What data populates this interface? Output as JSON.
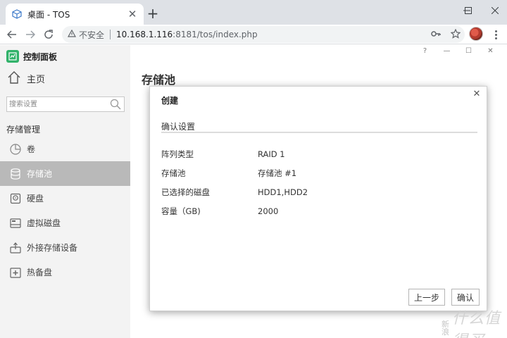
{
  "browser": {
    "tab_title": "桌面 - TOS",
    "tab_close": "✕",
    "new_tab": "+",
    "minimize": "—",
    "maximize": "☐",
    "close": "✕",
    "insecure_label": "不安全",
    "url_host": "10.168.1.116",
    "url_rest": ":8181/tos/index.php"
  },
  "sidebar": {
    "app_title": "控制面板",
    "home_label": "主页",
    "search_placeholder": "搜索设置",
    "section_title": "存储管理",
    "items": [
      {
        "label": "卷",
        "icon": "pie-chart-icon",
        "active": false
      },
      {
        "label": "存储池",
        "icon": "database-icon",
        "active": true
      },
      {
        "label": "硬盘",
        "icon": "hard-disk-icon",
        "active": false
      },
      {
        "label": "虚拟磁盘",
        "icon": "virtual-disk-icon",
        "active": false
      },
      {
        "label": "外接存储设备",
        "icon": "usb-drive-icon",
        "active": false
      },
      {
        "label": "热备盘",
        "icon": "hot-spare-icon",
        "active": false
      }
    ]
  },
  "main": {
    "help": "?",
    "minimize": "—",
    "maximize": "☐",
    "close": "✕",
    "page_title": "存储池"
  },
  "modal": {
    "title": "创建",
    "close": "✕",
    "section_title": "确认设置",
    "rows": [
      {
        "label": "阵列类型",
        "value": "RAID 1"
      },
      {
        "label": "存储池",
        "value": "存储池 #1"
      },
      {
        "label": "已选择的磁盘",
        "value": "HDD1,HDD2"
      },
      {
        "label": "容量（GB)",
        "value": "2000"
      }
    ],
    "prev_button": "上一步",
    "confirm_button": "确认"
  },
  "watermark": {
    "vertical_text": "新浪",
    "text": "什么值得买"
  },
  "colors": {
    "sidebar_bg": "#f3f3f3",
    "active_item_bg": "#b9b9b9",
    "app_logo": "#31b26a",
    "browser_tabbar": "#dee1e6"
  }
}
